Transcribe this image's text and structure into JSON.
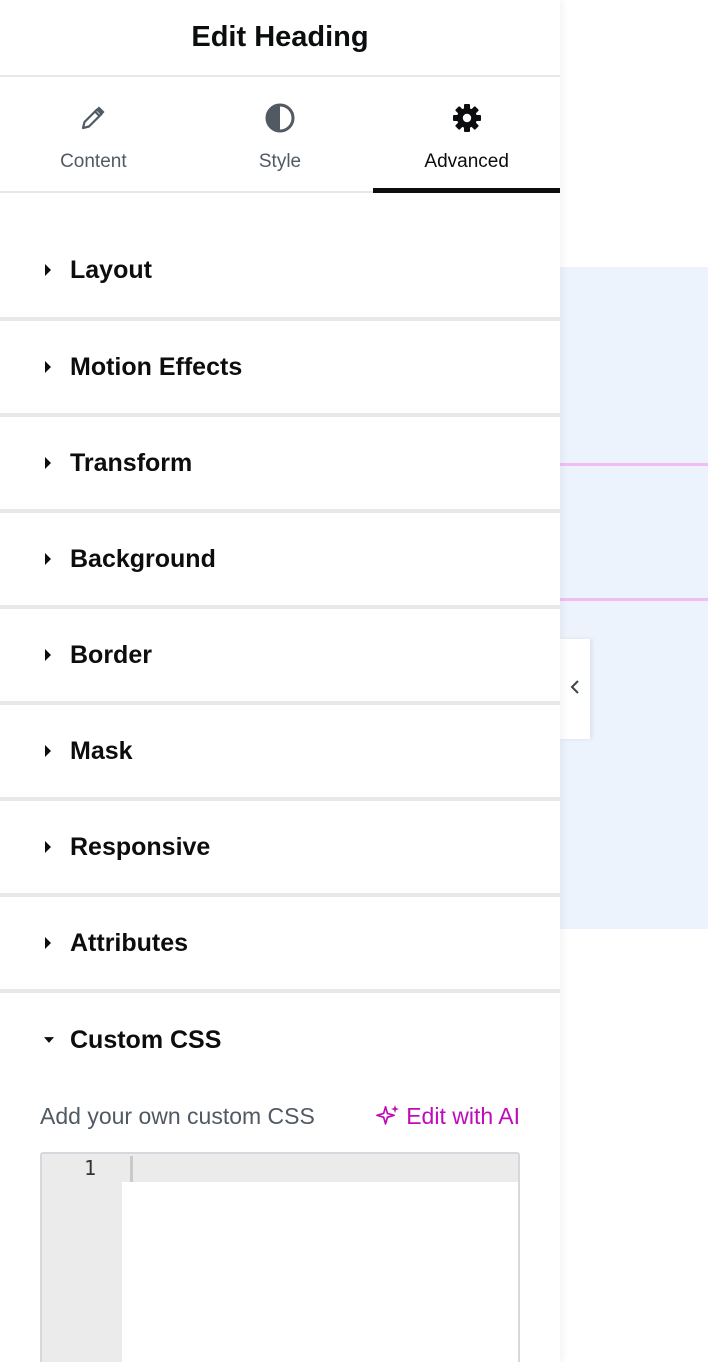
{
  "panel": {
    "title": "Edit Heading"
  },
  "tabs": [
    {
      "label": "Content",
      "icon": "pencil-icon",
      "active": false
    },
    {
      "label": "Style",
      "icon": "half-circle-icon",
      "active": false
    },
    {
      "label": "Advanced",
      "icon": "gear-icon",
      "active": true
    }
  ],
  "sections": {
    "layout": "Layout",
    "motion_effects": "Motion Effects",
    "transform": "Transform",
    "background": "Background",
    "border": "Border",
    "mask": "Mask",
    "responsive": "Responsive",
    "attributes": "Attributes",
    "custom_css": "Custom CSS"
  },
  "custom_css": {
    "label": "Add your own custom CSS",
    "ai_button": "Edit with AI",
    "line_number": "1",
    "code": ""
  },
  "colors": {
    "accent_ai": "#c00bb9",
    "canvas_bg": "#edf3fd",
    "canvas_guides": "#f2bdf6"
  }
}
